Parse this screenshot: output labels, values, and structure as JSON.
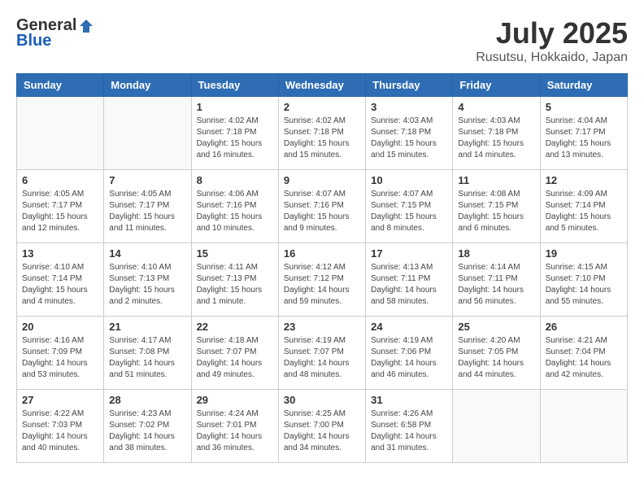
{
  "logo": {
    "general": "General",
    "blue": "Blue"
  },
  "title": "July 2025",
  "location": "Rusutsu, Hokkaido, Japan",
  "weekdays": [
    "Sunday",
    "Monday",
    "Tuesday",
    "Wednesday",
    "Thursday",
    "Friday",
    "Saturday"
  ],
  "weeks": [
    [
      {
        "day": "",
        "details": ""
      },
      {
        "day": "",
        "details": ""
      },
      {
        "day": "1",
        "details": "Sunrise: 4:02 AM\nSunset: 7:18 PM\nDaylight: 15 hours\nand 16 minutes."
      },
      {
        "day": "2",
        "details": "Sunrise: 4:02 AM\nSunset: 7:18 PM\nDaylight: 15 hours\nand 15 minutes."
      },
      {
        "day": "3",
        "details": "Sunrise: 4:03 AM\nSunset: 7:18 PM\nDaylight: 15 hours\nand 15 minutes."
      },
      {
        "day": "4",
        "details": "Sunrise: 4:03 AM\nSunset: 7:18 PM\nDaylight: 15 hours\nand 14 minutes."
      },
      {
        "day": "5",
        "details": "Sunrise: 4:04 AM\nSunset: 7:17 PM\nDaylight: 15 hours\nand 13 minutes."
      }
    ],
    [
      {
        "day": "6",
        "details": "Sunrise: 4:05 AM\nSunset: 7:17 PM\nDaylight: 15 hours\nand 12 minutes."
      },
      {
        "day": "7",
        "details": "Sunrise: 4:05 AM\nSunset: 7:17 PM\nDaylight: 15 hours\nand 11 minutes."
      },
      {
        "day": "8",
        "details": "Sunrise: 4:06 AM\nSunset: 7:16 PM\nDaylight: 15 hours\nand 10 minutes."
      },
      {
        "day": "9",
        "details": "Sunrise: 4:07 AM\nSunset: 7:16 PM\nDaylight: 15 hours\nand 9 minutes."
      },
      {
        "day": "10",
        "details": "Sunrise: 4:07 AM\nSunset: 7:15 PM\nDaylight: 15 hours\nand 8 minutes."
      },
      {
        "day": "11",
        "details": "Sunrise: 4:08 AM\nSunset: 7:15 PM\nDaylight: 15 hours\nand 6 minutes."
      },
      {
        "day": "12",
        "details": "Sunrise: 4:09 AM\nSunset: 7:14 PM\nDaylight: 15 hours\nand 5 minutes."
      }
    ],
    [
      {
        "day": "13",
        "details": "Sunrise: 4:10 AM\nSunset: 7:14 PM\nDaylight: 15 hours\nand 4 minutes."
      },
      {
        "day": "14",
        "details": "Sunrise: 4:10 AM\nSunset: 7:13 PM\nDaylight: 15 hours\nand 2 minutes."
      },
      {
        "day": "15",
        "details": "Sunrise: 4:11 AM\nSunset: 7:13 PM\nDaylight: 15 hours\nand 1 minute."
      },
      {
        "day": "16",
        "details": "Sunrise: 4:12 AM\nSunset: 7:12 PM\nDaylight: 14 hours\nand 59 minutes."
      },
      {
        "day": "17",
        "details": "Sunrise: 4:13 AM\nSunset: 7:11 PM\nDaylight: 14 hours\nand 58 minutes."
      },
      {
        "day": "18",
        "details": "Sunrise: 4:14 AM\nSunset: 7:11 PM\nDaylight: 14 hours\nand 56 minutes."
      },
      {
        "day": "19",
        "details": "Sunrise: 4:15 AM\nSunset: 7:10 PM\nDaylight: 14 hours\nand 55 minutes."
      }
    ],
    [
      {
        "day": "20",
        "details": "Sunrise: 4:16 AM\nSunset: 7:09 PM\nDaylight: 14 hours\nand 53 minutes."
      },
      {
        "day": "21",
        "details": "Sunrise: 4:17 AM\nSunset: 7:08 PM\nDaylight: 14 hours\nand 51 minutes."
      },
      {
        "day": "22",
        "details": "Sunrise: 4:18 AM\nSunset: 7:07 PM\nDaylight: 14 hours\nand 49 minutes."
      },
      {
        "day": "23",
        "details": "Sunrise: 4:19 AM\nSunset: 7:07 PM\nDaylight: 14 hours\nand 48 minutes."
      },
      {
        "day": "24",
        "details": "Sunrise: 4:19 AM\nSunset: 7:06 PM\nDaylight: 14 hours\nand 46 minutes."
      },
      {
        "day": "25",
        "details": "Sunrise: 4:20 AM\nSunset: 7:05 PM\nDaylight: 14 hours\nand 44 minutes."
      },
      {
        "day": "26",
        "details": "Sunrise: 4:21 AM\nSunset: 7:04 PM\nDaylight: 14 hours\nand 42 minutes."
      }
    ],
    [
      {
        "day": "27",
        "details": "Sunrise: 4:22 AM\nSunset: 7:03 PM\nDaylight: 14 hours\nand 40 minutes."
      },
      {
        "day": "28",
        "details": "Sunrise: 4:23 AM\nSunset: 7:02 PM\nDaylight: 14 hours\nand 38 minutes."
      },
      {
        "day": "29",
        "details": "Sunrise: 4:24 AM\nSunset: 7:01 PM\nDaylight: 14 hours\nand 36 minutes."
      },
      {
        "day": "30",
        "details": "Sunrise: 4:25 AM\nSunset: 7:00 PM\nDaylight: 14 hours\nand 34 minutes."
      },
      {
        "day": "31",
        "details": "Sunrise: 4:26 AM\nSunset: 6:58 PM\nDaylight: 14 hours\nand 31 minutes."
      },
      {
        "day": "",
        "details": ""
      },
      {
        "day": "",
        "details": ""
      }
    ]
  ]
}
